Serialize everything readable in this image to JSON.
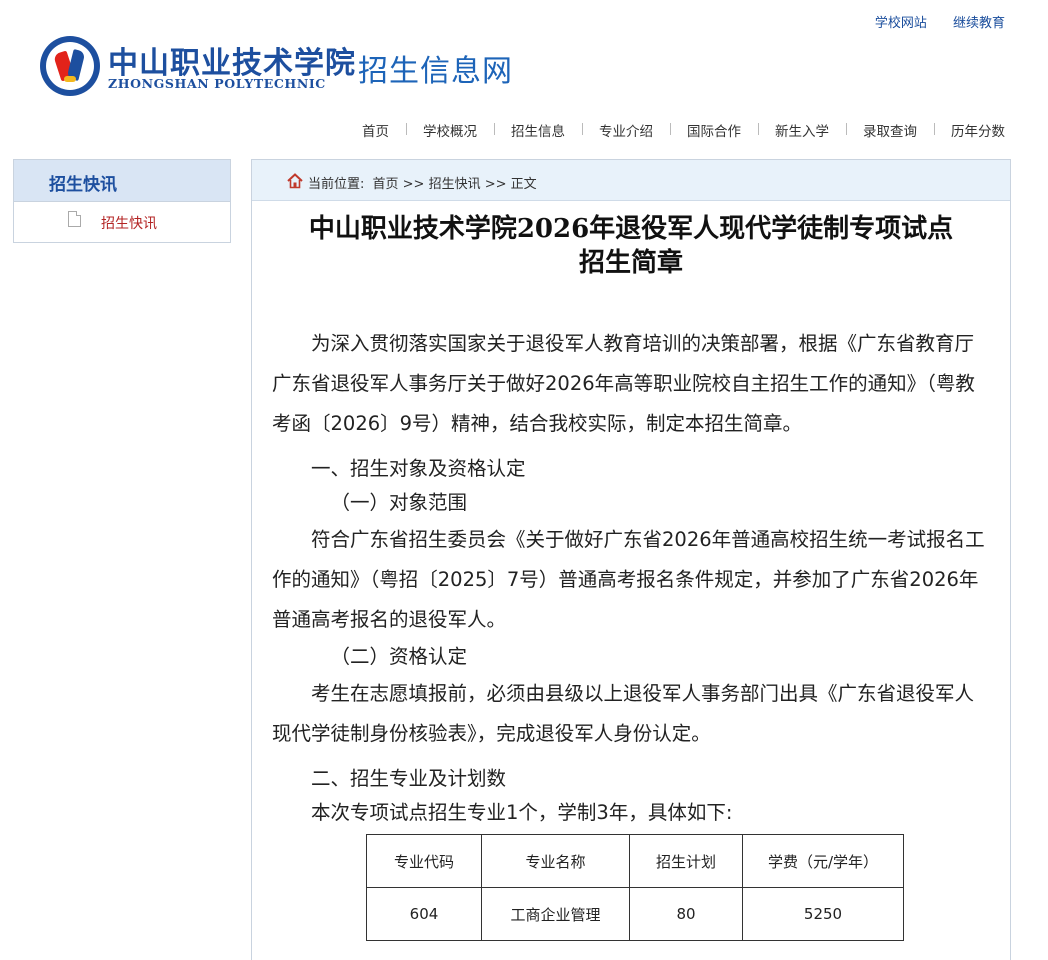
{
  "top_links": [
    "学校网站",
    "继续教育"
  ],
  "header": {
    "school_cn": "中山职业技术学院",
    "school_en": "ZHONGSHAN POLYTECHNIC",
    "site_title": "招生信息网"
  },
  "nav": [
    "首页",
    "学校概况",
    "招生信息",
    "专业介绍",
    "国际合作",
    "新生入学",
    "录取查询",
    "历年分数"
  ],
  "sidebar": {
    "title": "招生快讯",
    "items": [
      "招生快讯"
    ]
  },
  "breadcrumb": {
    "label": "当前位置:",
    "path": "首页 >> 招生快讯 >> 正文"
  },
  "article": {
    "title_line1": "中山职业技术学院2026年退役军人现代学徒制专项试点",
    "title_line2": "招生简章",
    "intro": "为深入贯彻落实国家关于退役军人教育培训的决策部署，根据《广东省教育厅 广东省退役军人事务厅关于做好2026年高等职业院校自主招生工作的通知》（粤教考函〔2026〕9号）精神，结合我校实际，制定本招生简章。",
    "sec1_title": "一、招生对象及资格认定",
    "sec1_sub1": "（一）对象范围",
    "sec1_sub1_text": "符合广东省招生委员会《关于做好广东省2026年普通高校招生统一考试报名工作的通知》（粤招〔2025〕7号）普通高考报名条件规定，并参加了广东省2026年普通高考报名的退役军人。",
    "sec1_sub2": "（二）资格认定",
    "sec1_sub2_text": "考生在志愿填报前，必须由县级以上退役军人事务部门出具《广东省退役军人现代学徒制身份核验表》，完成退役军人身份认定。",
    "sec2_title": "二、招生专业及计划数",
    "sec2_text": "本次专项试点招生专业1个，学制3年，具体如下:"
  },
  "table": {
    "headers": [
      "专业代码",
      "专业名称",
      "招生计划",
      "学费（元/学年）"
    ],
    "rows": [
      [
        "604",
        "工商企业管理",
        "80",
        "5250"
      ]
    ]
  }
}
